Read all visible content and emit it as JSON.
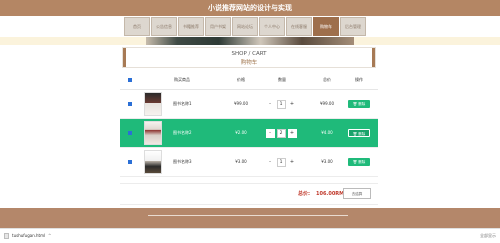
{
  "site": {
    "title": "小说推荐网站的设计与实现"
  },
  "nav": {
    "items": [
      {
        "label": "首页",
        "active": false
      },
      {
        "label": "公告信息",
        "active": false
      },
      {
        "label": "书籍推荐",
        "active": false
      },
      {
        "label": "用户书架",
        "active": false
      },
      {
        "label": "网站论坛",
        "active": false
      },
      {
        "label": "个人中心",
        "active": false
      },
      {
        "label": "在线客服",
        "active": false
      },
      {
        "label": "购物车",
        "active": true
      },
      {
        "label": "后台管理",
        "active": false
      }
    ]
  },
  "cart_header": {
    "title_en": "SHOP / CART",
    "title_zh": "购物车"
  },
  "table": {
    "headers": {
      "product": "购买商品",
      "price": "价格",
      "qty": "数量",
      "total": "总价",
      "action": "操作"
    },
    "rows": [
      {
        "name": "图书名称1",
        "price": "¥99.00",
        "qty": "1",
        "subtotal": "¥99.00",
        "delete": "删除",
        "active": false
      },
      {
        "name": "图书名称2",
        "price": "¥2.00",
        "qty": "2",
        "subtotal": "¥4.00",
        "delete": "删除",
        "active": true
      },
      {
        "name": "图书名称3",
        "price": "¥3.00",
        "qty": "1",
        "subtotal": "¥3.00",
        "delete": "删除",
        "active": false
      }
    ]
  },
  "summary": {
    "total_label": "总价:",
    "total_value": "106.00RMB",
    "pay_label": "去结算"
  },
  "downloads": {
    "filename": "tushufugan.html",
    "caret": "^",
    "right_text": "全部显示"
  },
  "colors": {
    "brand_brown": "#b48664",
    "accent_green": "#1fba7a",
    "total_red": "#c0392b"
  }
}
